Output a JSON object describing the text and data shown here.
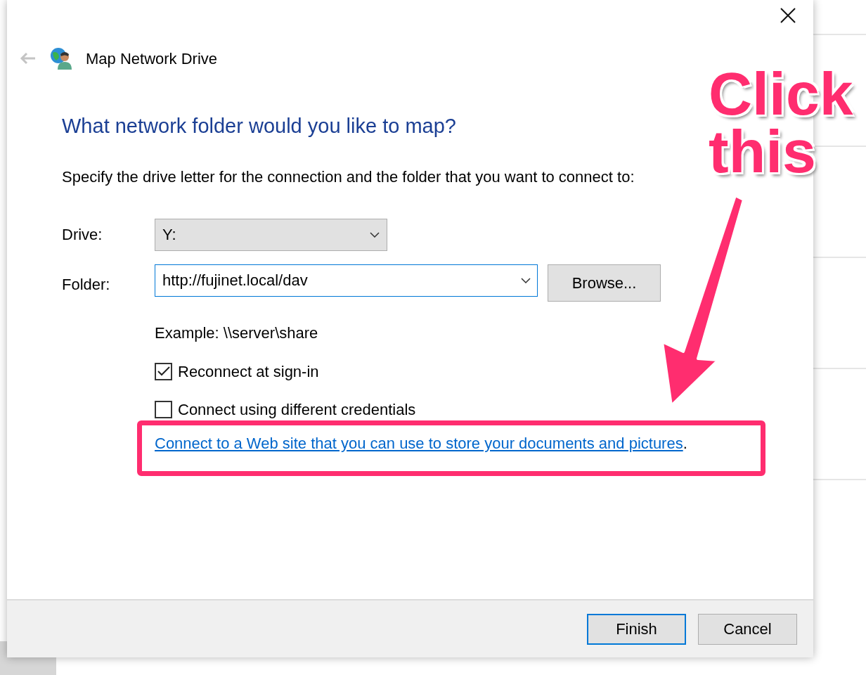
{
  "dialog": {
    "title": "Map Network Drive",
    "back_enabled": false,
    "heading": "What network folder would you like to map?",
    "instruction": "Specify the drive letter for the connection and the folder that you want to connect to:",
    "drive": {
      "label": "Drive:",
      "value": "Y:"
    },
    "folder": {
      "label": "Folder:",
      "value": "http://fujinet.local/dav"
    },
    "browse_button": "Browse...",
    "example": "Example: \\\\server\\share",
    "checkboxes": [
      {
        "label": "Reconnect at sign-in",
        "checked": true
      },
      {
        "label": "Connect using different credentials",
        "checked": false
      }
    ],
    "link": {
      "text": "Connect to a Web site that you can use to store your documents and pictures",
      "after": "."
    },
    "buttons": [
      {
        "label": "Finish",
        "default": true
      },
      {
        "label": "Cancel",
        "default": false
      }
    ]
  },
  "annotation": {
    "lines": [
      "Click",
      "this"
    ]
  }
}
